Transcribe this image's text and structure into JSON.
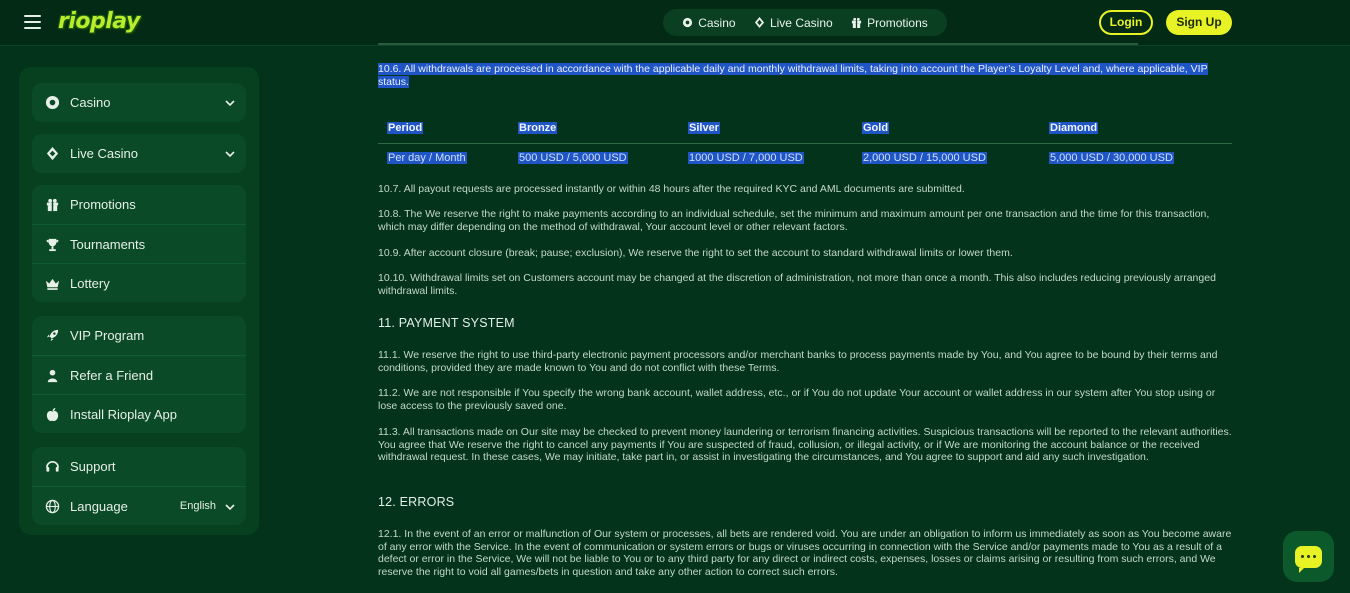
{
  "header": {
    "logo": "rioplay",
    "nav": [
      {
        "label": "Casino",
        "icon": "casino-chip-icon"
      },
      {
        "label": "Live Casino",
        "icon": "diamond-suit-icon"
      },
      {
        "label": "Promotions",
        "icon": "gift-icon"
      }
    ],
    "login_label": "Login",
    "signup_label": "Sign Up"
  },
  "sidebar": {
    "casino": "Casino",
    "live_casino": "Live Casino",
    "promotions": "Promotions",
    "tournaments": "Tournaments",
    "lottery": "Lottery",
    "vip": "VIP Program",
    "refer": "Refer a Friend",
    "install": "Install Rioplay App",
    "support": "Support",
    "language": "Language",
    "language_value": "English"
  },
  "content": {
    "p_10_6": "10.6. All withdrawals are processed in accordance with the applicable daily and monthly withdrawal limits, taking into account the Player’s Loyalty Level and, where applicable, VIP status.",
    "table": {
      "headers": [
        "Period",
        "Bronze",
        "Silver",
        "Gold",
        "Diamond"
      ],
      "row": [
        "Per day / Month",
        "500 USD / 5,000 USD",
        "1000 USD / 7,000 USD",
        "2,000 USD / 15,000 USD",
        "5,000 USD / 30,000 USD"
      ]
    },
    "p_10_7": "10.7. All payout requests are processed instantly or within 48 hours after the required KYC and AML documents are submitted.",
    "p_10_8": "10.8. The We reserve the right to make payments according to an individual schedule, set the minimum and maximum amount per one transaction and the time for this transaction, which may differ depending on the method of withdrawal, Your account level or other relevant factors.",
    "p_10_9": "10.9. After account closure (break; pause; exclusion), We reserve the right to set the account to standard withdrawal limits or lower them.",
    "p_10_10": "10.10. Withdrawal limits set on Customers account may be changed at the discretion of administration, not more than once a month. This also includes reducing previously arranged withdrawal limits.",
    "h_11": "11. PAYMENT SYSTEM",
    "p_11_1": "11.1. We reserve the right to use third-party electronic payment processors and/or merchant banks to process payments made by You, and You agree to be bound by their terms and conditions, provided they are made known to You and do not conflict with these Terms.",
    "p_11_2": "11.2. We are not responsible if You specify the wrong bank account, wallet address, etc., or if You do not update Your account or wallet address in our system after You stop using or lose access to the previously saved one.",
    "p_11_3": "11.3. All transactions made on Our site may be checked to prevent money laundering or terrorism financing activities. Suspicious transactions will be reported to the relevant authorities. You agree that We reserve the right to cancel any payments if You are suspected of fraud, collusion, or illegal activity, or if We are monitoring the account balance or the received withdrawal request. In these cases, We may initiate, take part in, or assist in investigating the circumstances, and You agree to support and aid any such investigation.",
    "h_12": "12. ERRORS",
    "p_12_1": "12.1. In the event of an error or malfunction of Our system or processes, all bets are rendered void. You are under an obligation to inform us immediately as soon as You become aware of any error with the Service. In the event of communication or system errors or bugs or viruses occurring in connection with the Service and/or payments made to You as a result of a defect or error in the Service, We will not be liable to You or to any third party for any direct or indirect costs, expenses, losses or claims arising or resulting from such errors, and We reserve the right to void all games/bets in question and take any other action to correct such errors."
  },
  "colors": {
    "accent": "#e8f326",
    "background": "#03331a",
    "selection": "#1f55c4"
  }
}
